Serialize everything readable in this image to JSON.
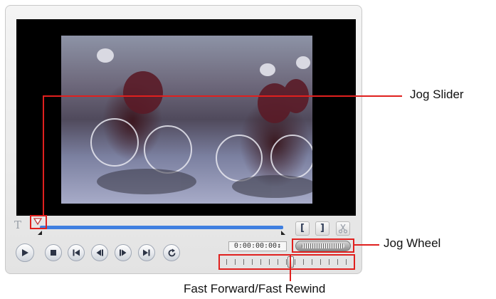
{
  "player": {
    "title_button": "T",
    "mark_in_label": "[",
    "mark_out_label": "]",
    "timecode": "0:00:00:00",
    "timecode_spinner": "↕"
  },
  "transport": [
    {
      "name": "play-button",
      "icon": "play-icon"
    },
    {
      "name": "stop-button",
      "icon": "stop-icon"
    },
    {
      "name": "go-to-start-button",
      "icon": "skip-back-icon"
    },
    {
      "name": "previous-frame-button",
      "icon": "step-back-icon"
    },
    {
      "name": "next-frame-button",
      "icon": "step-forward-icon"
    },
    {
      "name": "go-to-end-button",
      "icon": "skip-forward-icon"
    },
    {
      "name": "repeat-button",
      "icon": "repeat-icon"
    }
  ],
  "callouts": {
    "jog_slider": "Jog Slider",
    "jog_wheel": "Jog Wheel",
    "fast_forward_rewind": "Fast Forward/Fast Rewind"
  },
  "colors": {
    "callout": "#e0201e",
    "track": "#3f7fe0",
    "screen": "#000000"
  }
}
